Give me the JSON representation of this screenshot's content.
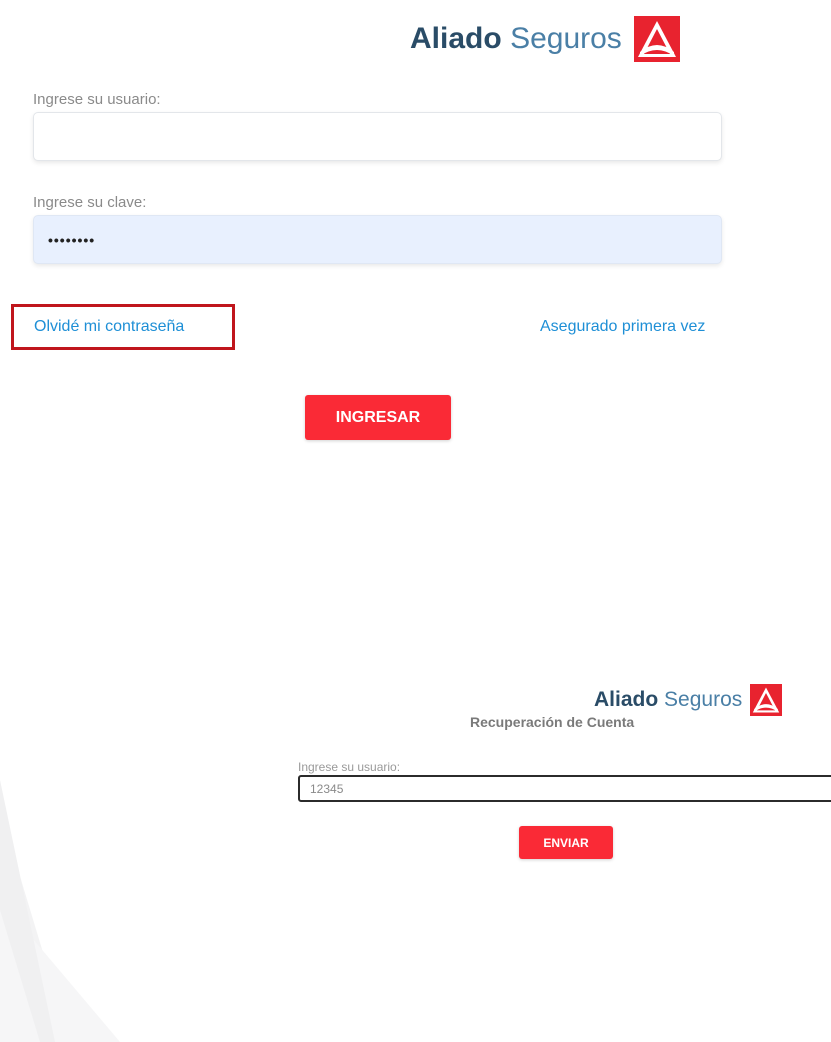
{
  "brand": {
    "name_bold": "Aliado",
    "name_light": "Seguros",
    "colors": {
      "dark": "#2a4c67",
      "light": "#4a7fa6",
      "accent": "#fa2a36"
    },
    "logo_icon": "aliado-triangle-logo"
  },
  "login": {
    "user_label": "Ingrese su usuario:",
    "user_value": "",
    "password_label": "Ingrese su clave:",
    "password_value": "••••••••",
    "forgot_link": "Olvidé mi contraseña",
    "first_time_link": "Asegurado primera vez",
    "submit_label": "INGRESAR",
    "highlight_color": "#c0151c"
  },
  "recovery": {
    "title": "Recuperación de Cuenta",
    "user_label": "Ingrese su usuario:",
    "user_value": "12345",
    "submit_label": "ENVIAR"
  }
}
